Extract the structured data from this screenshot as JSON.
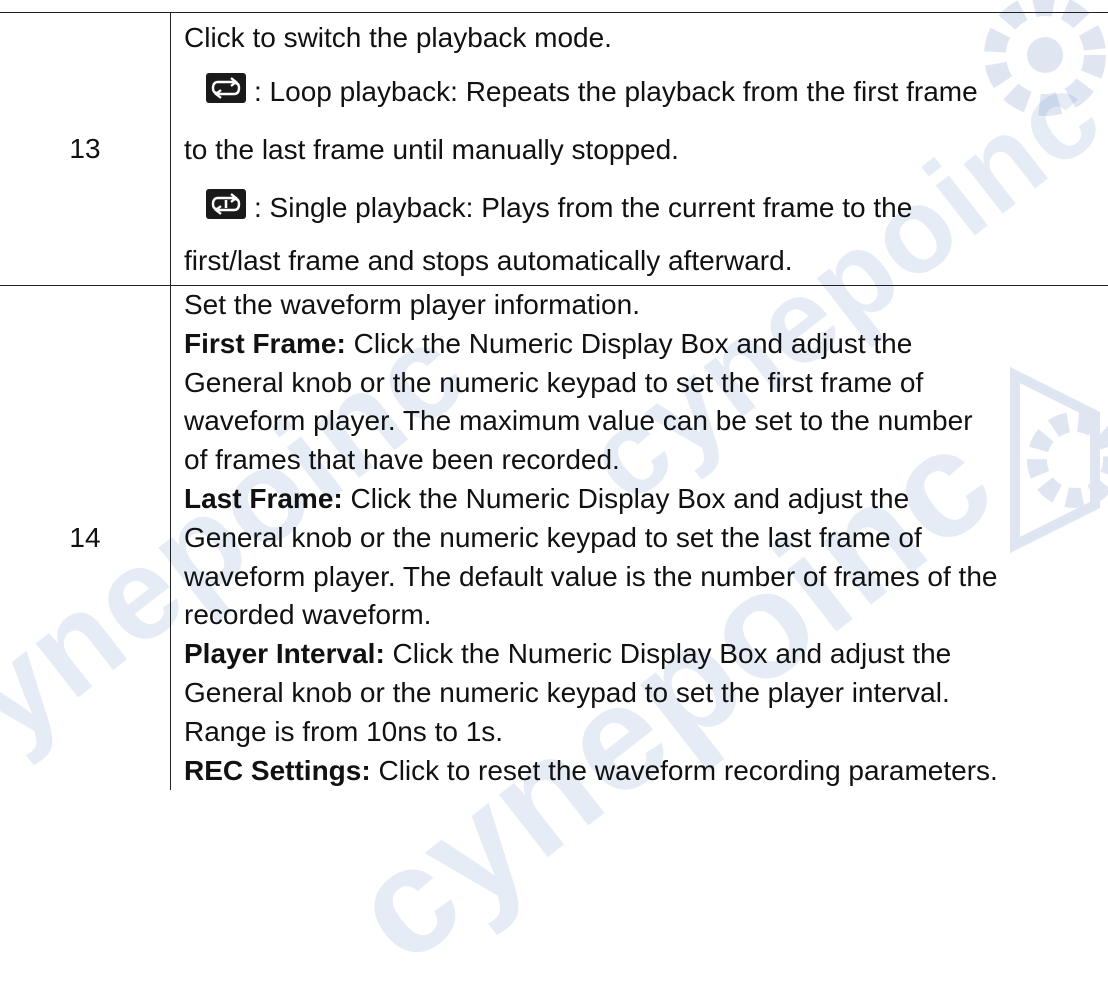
{
  "watermark": {
    "text": "cynepoinc",
    "color": "#3d69b5"
  },
  "rows": [
    {
      "number": "13",
      "intro": "Click to switch the playback mode.",
      "modes": [
        {
          "icon": "loop-playback-icon",
          "line1": ": Loop playback: Repeats the playback from the first frame",
          "line2": "to the last frame until manually stopped."
        },
        {
          "icon": "single-playback-icon",
          "line1": ": Single playback: Plays from the current frame to the",
          "line2": "first/last frame and stops automatically afterward."
        }
      ]
    },
    {
      "number": "14",
      "intro": "Set the waveform player information.",
      "items": [
        {
          "term": "First Frame:",
          "lines": [
            " Click the Numeric Display Box and adjust the",
            "General knob or the numeric keypad to set the first frame of",
            "waveform player. The maximum value can be set to the number",
            "of frames that have been recorded."
          ]
        },
        {
          "term": "Last Frame:",
          "lines": [
            " Click the Numeric Display Box and adjust the",
            "General knob or the numeric keypad to set the last frame of",
            "waveform player. The default value is the number of frames of the",
            "recorded waveform."
          ]
        },
        {
          "term": "Player Interval:",
          "lines": [
            " Click the Numeric Display Box and adjust the",
            "General knob or the numeric keypad to set the player interval.",
            "Range is from 10ns to 1s."
          ]
        },
        {
          "term": "REC Settings:",
          "lines": [
            " Click to reset the waveform recording parameters."
          ]
        }
      ]
    }
  ]
}
